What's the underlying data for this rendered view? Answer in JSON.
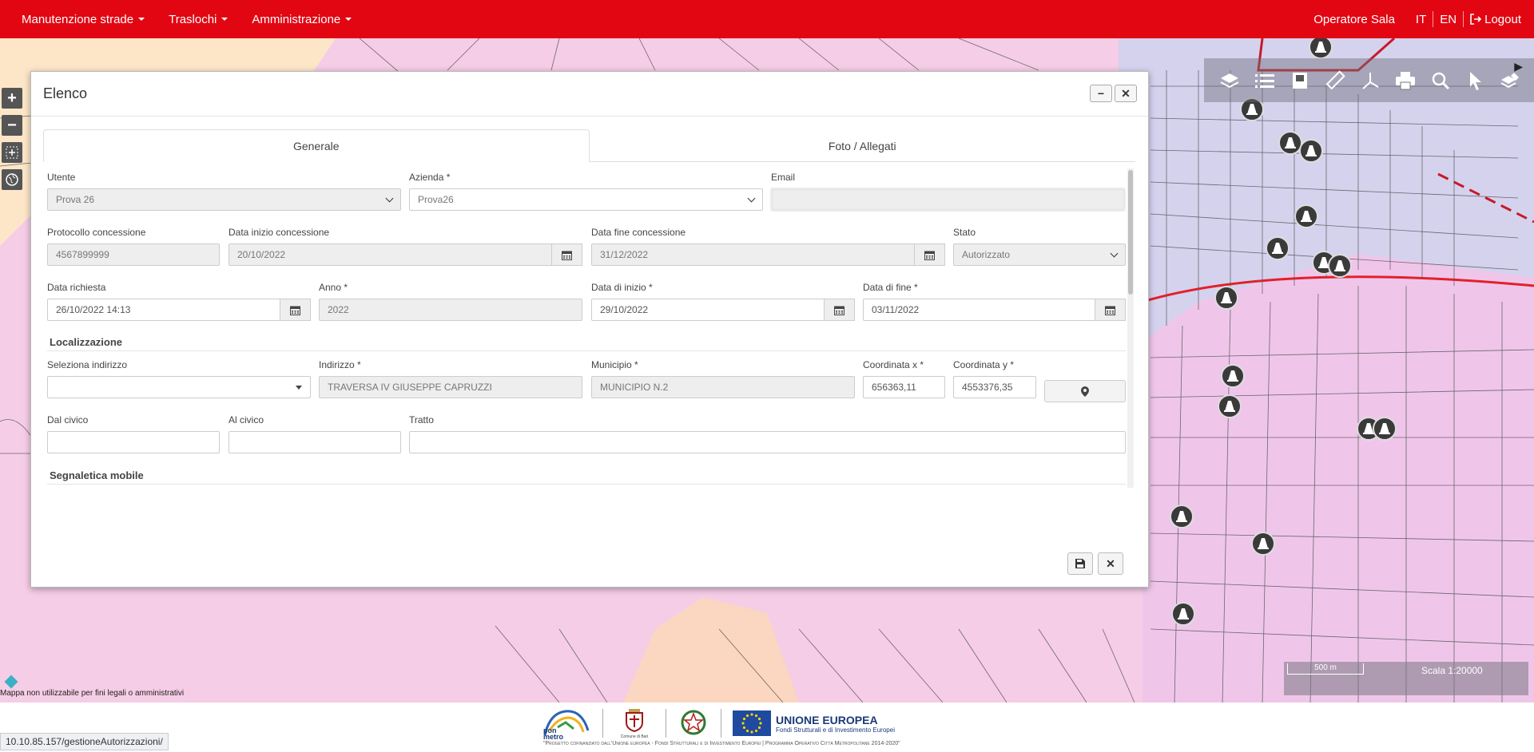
{
  "nav": {
    "menu": [
      {
        "label": "Manutenzione strade"
      },
      {
        "label": "Traslochi"
      },
      {
        "label": "Amministrazione"
      }
    ],
    "user": "Operatore Sala",
    "lang_it": "IT",
    "lang_en": "EN",
    "logout": "Logout"
  },
  "map": {
    "disclaimer": "Mappa non utilizzabile per fini legali o amministrativi",
    "scale_ruler": "500 m",
    "scale_label": "Scala 1:20000",
    "tools": [
      "layers-icon",
      "list-icon",
      "book-icon",
      "ruler-icon",
      "axes-icon",
      "print-icon",
      "search-icon",
      "pointer-icon",
      "edit-layer-icon"
    ]
  },
  "modal": {
    "title": "Elenco",
    "tabs": [
      "Generale",
      "Foto / Allegati"
    ],
    "fields": {
      "utente": {
        "label": "Utente",
        "value": "Prova 26"
      },
      "azienda": {
        "label": "Azienda *",
        "value": "Prova26"
      },
      "email": {
        "label": "Email",
        "value": ""
      },
      "protocollo": {
        "label": "Protocollo concessione",
        "value": "4567899999"
      },
      "data_inizio_conc": {
        "label": "Data inizio concessione",
        "value": "20/10/2022"
      },
      "data_fine_conc": {
        "label": "Data fine concessione",
        "value": "31/12/2022"
      },
      "stato": {
        "label": "Stato",
        "value": "Autorizzato"
      },
      "data_richiesta": {
        "label": "Data richiesta",
        "value": "26/10/2022 14:13"
      },
      "anno": {
        "label": "Anno *",
        "value": "2022"
      },
      "data_inizio": {
        "label": "Data di inizio *",
        "value": "29/10/2022"
      },
      "data_fine": {
        "label": "Data di fine *",
        "value": "03/11/2022"
      },
      "seleziona_indirizzo": {
        "label": "Seleziona indirizzo",
        "value": ""
      },
      "indirizzo": {
        "label": "Indirizzo *",
        "value": "TRAVERSA IV GIUSEPPE CAPRUZZI"
      },
      "municipio": {
        "label": "Municipio *",
        "value": "MUNICIPIO N.2"
      },
      "coord_x": {
        "label": "Coordinata x *",
        "value": "656363,11"
      },
      "coord_y": {
        "label": "Coordinata y *",
        "value": "4553376,35"
      },
      "dal_civico": {
        "label": "Dal civico",
        "value": ""
      },
      "al_civico": {
        "label": "Al civico",
        "value": ""
      },
      "tratto": {
        "label": "Tratto",
        "value": ""
      }
    },
    "sections": {
      "localizzazione": "Localizzazione",
      "segnaletica": "Segnaletica mobile"
    }
  },
  "footer": {
    "url": "10.10.85.157/gestioneAutorizzazioni/",
    "pon_text": "pon metro",
    "comune": "Comune di Bari",
    "ue_title": "UNIONE EUROPEA",
    "ue_subtitle": "Fondi Strutturali e di Investimento Europei",
    "caption": "\"Progetto cofinanziato dall'Unione europea - Fondi Strutturali e di Investimento Europei | Programma Operativo Città Metropolitane 2014-2020\""
  }
}
